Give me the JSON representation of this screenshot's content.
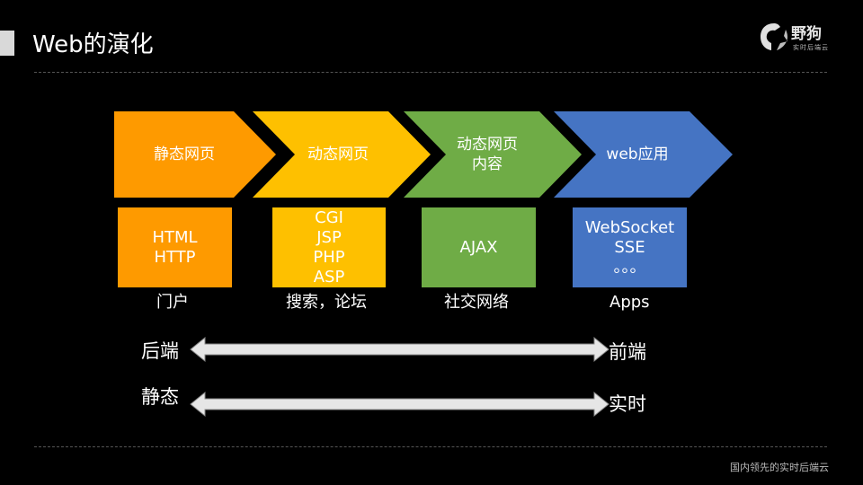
{
  "slide": {
    "title": "Web的演化"
  },
  "logo": {
    "name": "野狗",
    "tagline": "实时后端云"
  },
  "stages": [
    {
      "label": "静态网页",
      "color": "#fe9a00",
      "box_lines": "HTML\nHTTP",
      "box_color": "#fe9a00",
      "caption": "门户"
    },
    {
      "label": "动态网页",
      "color": "#fec000",
      "box_lines": "CGI\nJSP\nPHP\nASP",
      "box_color": "#fec000",
      "caption": "搜索，论坛"
    },
    {
      "label": "动态网页\n内容",
      "color": "#6fac46",
      "box_lines": "AJAX",
      "box_color": "#6fac46",
      "caption": "社交网络"
    },
    {
      "label": "web应用",
      "color": "#4574c3",
      "box_lines": "WebSocket\nSSE\n。。。",
      "box_color": "#4574c3",
      "caption": "Apps"
    }
  ],
  "arrows": [
    {
      "left": "后端",
      "right": "前端"
    },
    {
      "left": "静态",
      "right": "实时"
    }
  ],
  "footer": {
    "text": "国内领先的实时后端云"
  }
}
